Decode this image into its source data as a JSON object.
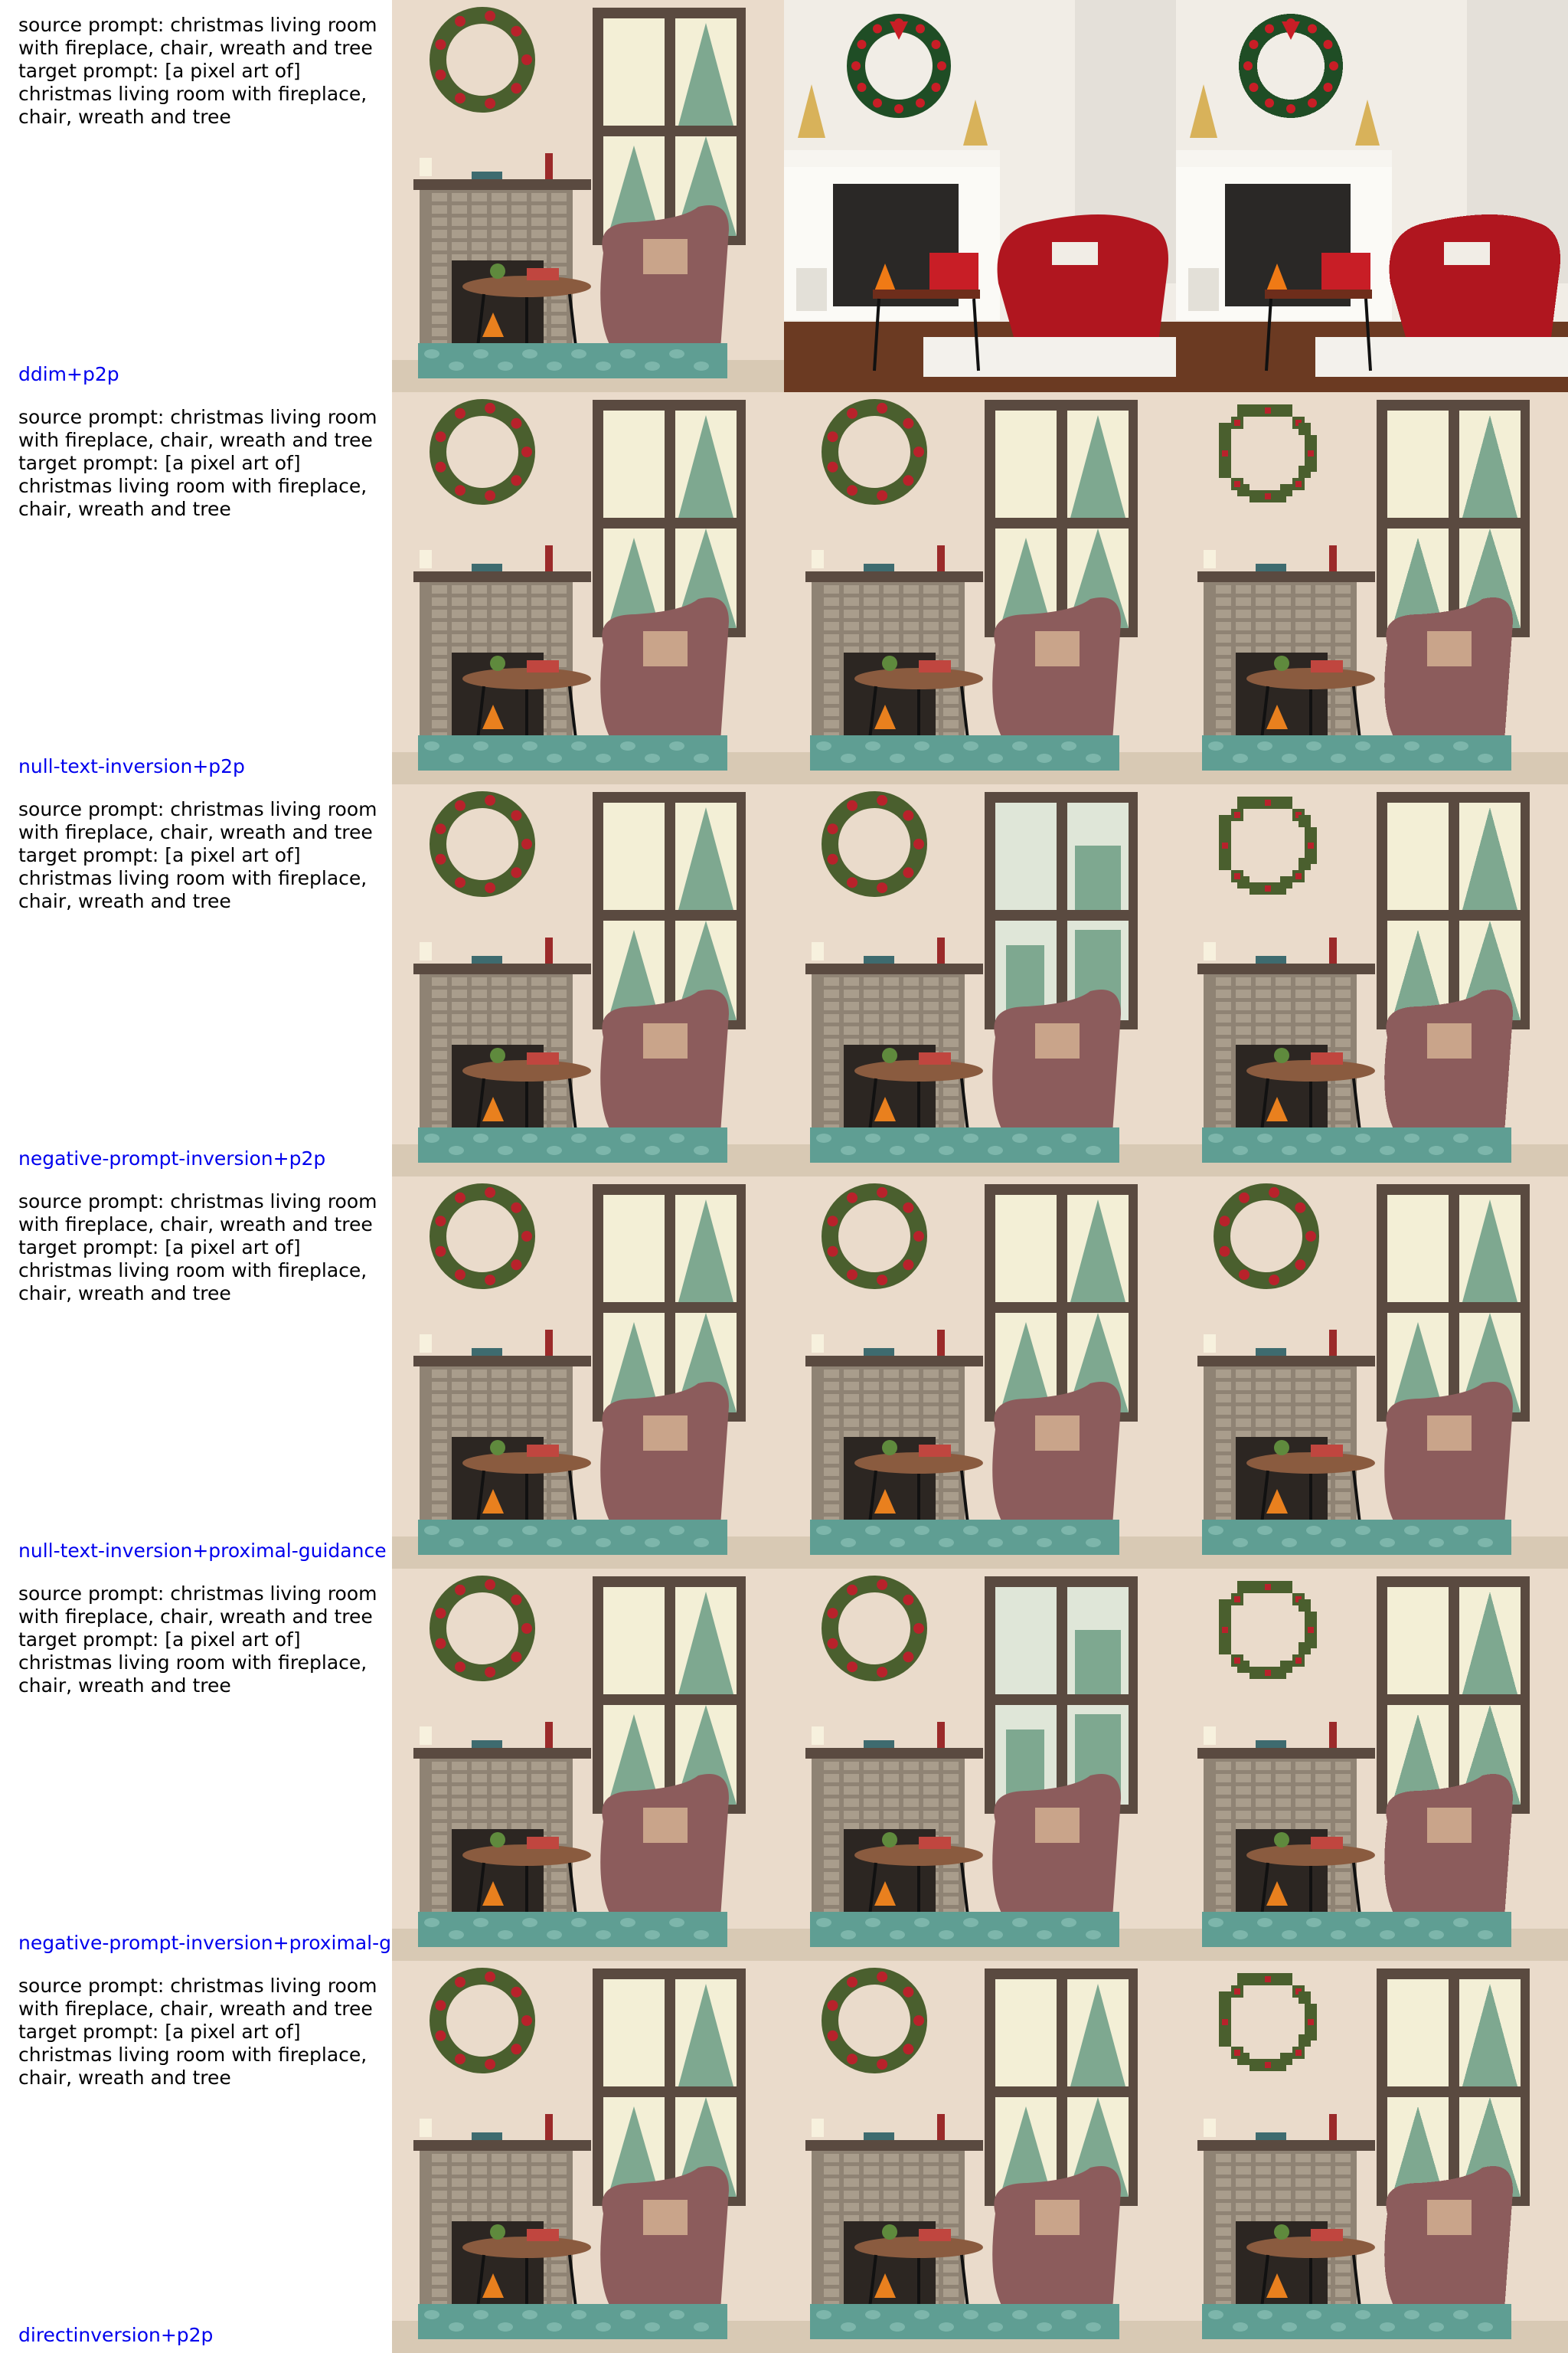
{
  "rows": [
    {
      "prompt": "source prompt: christmas living room\nwith fireplace, chair, wreath and tree\ntarget prompt: [a pixel art of]\nchristmas living room with fireplace,\nchair, wreath and tree",
      "method": "ddim+p2p",
      "images": [
        {
          "kind": "illustration"
        },
        {
          "kind": "photo"
        },
        {
          "kind": "photo-pixel"
        }
      ]
    },
    {
      "prompt": "source prompt: christmas living room\nwith fireplace, chair, wreath and tree\ntarget prompt: [a pixel art of]\nchristmas living room with fireplace,\nchair, wreath and tree",
      "method": "null-text-inversion+p2p",
      "images": [
        {
          "kind": "illustration"
        },
        {
          "kind": "illustration"
        },
        {
          "kind": "illustration-pixel"
        }
      ]
    },
    {
      "prompt": "source prompt: christmas living room\nwith fireplace, chair, wreath and tree\ntarget prompt: [a pixel art of]\nchristmas living room with fireplace,\nchair, wreath and tree",
      "method": "negative-prompt-inversion+p2p",
      "images": [
        {
          "kind": "illustration"
        },
        {
          "kind": "illustration-blocky"
        },
        {
          "kind": "illustration-pixel"
        }
      ]
    },
    {
      "prompt": "source prompt: christmas living room\nwith fireplace, chair, wreath and tree\ntarget prompt: [a pixel art of]\nchristmas living room with fireplace,\nchair, wreath and tree",
      "method": "null-text-inversion+proximal-guidance",
      "images": [
        {
          "kind": "illustration"
        },
        {
          "kind": "illustration"
        },
        {
          "kind": "illustration"
        }
      ]
    },
    {
      "prompt": "source prompt: christmas living room\nwith fireplace, chair, wreath and tree\ntarget prompt: [a pixel art of]\nchristmas living room with fireplace,\nchair, wreath and tree",
      "method": "negative-prompt-inversion+proximal-g",
      "images": [
        {
          "kind": "illustration"
        },
        {
          "kind": "illustration-blocky"
        },
        {
          "kind": "illustration-pixel"
        }
      ]
    },
    {
      "prompt": "source prompt: christmas living room\nwith fireplace, chair, wreath and tree\ntarget prompt: [a pixel art of]\nchristmas living room with fireplace,\nchair, wreath and tree",
      "method": "directinversion+p2p",
      "images": [
        {
          "kind": "illustration"
        },
        {
          "kind": "illustration"
        },
        {
          "kind": "illustration-pixel"
        }
      ]
    }
  ],
  "colors": {
    "wall": "#eadbcb",
    "wood": "#5a4a40",
    "chair": "#8c5c5c",
    "rug": "#5f9e93",
    "wreath": "#4a5f2e",
    "berry": "#b8222b",
    "tree": "#7ea890",
    "red_chair": "#b0161f"
  }
}
